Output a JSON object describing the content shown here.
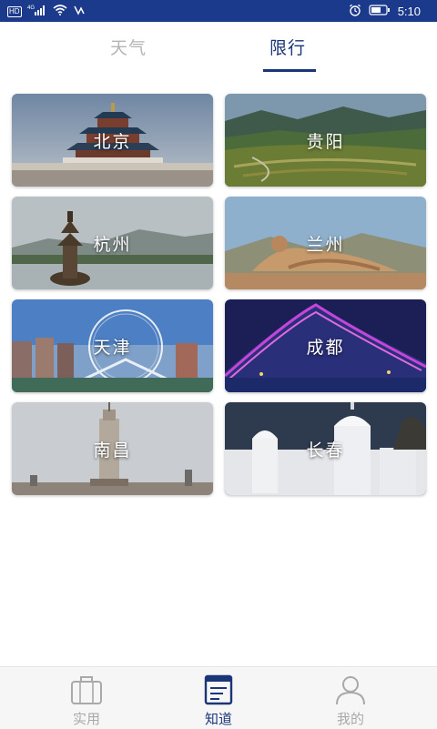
{
  "status_bar": {
    "network_badge": "HD",
    "network_type": "4G",
    "time": "5:10",
    "icons": [
      "hd-badge",
      "signal-icon",
      "wifi-icon",
      "data-speed-icon",
      "alarm-icon",
      "battery-icon"
    ]
  },
  "tabs": [
    {
      "label": "天气",
      "active": false
    },
    {
      "label": "限行",
      "active": true
    }
  ],
  "cities": [
    {
      "name": "北京"
    },
    {
      "name": "贵阳"
    },
    {
      "name": "杭州"
    },
    {
      "name": "兰州"
    },
    {
      "name": "天津"
    },
    {
      "name": "成都"
    },
    {
      "name": "南昌"
    },
    {
      "name": "长春"
    }
  ],
  "bottom_nav": [
    {
      "label": "实用",
      "icon": "briefcase-icon",
      "active": false
    },
    {
      "label": "知道",
      "icon": "document-icon",
      "active": true
    },
    {
      "label": "我的",
      "icon": "person-icon",
      "active": false
    }
  ],
  "colors": {
    "status_bar": "#1b3a8c",
    "accent": "#1a3578",
    "inactive": "#b4b4b4"
  }
}
